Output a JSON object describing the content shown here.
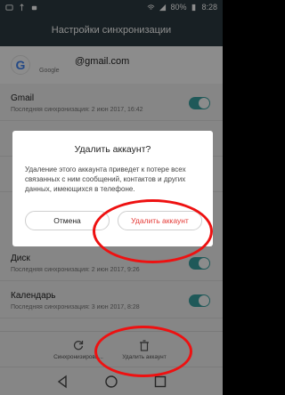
{
  "status_bar": {
    "battery": "80%",
    "time": "8:28",
    "icons": [
      "wifi-icon",
      "signal-icon",
      "battery-icon"
    ]
  },
  "title_bar": {
    "title": "Настройки синхронизации"
  },
  "account": {
    "email": "@gmail.com",
    "provider": "Google",
    "logo": "google-g-icon"
  },
  "sync_items": [
    {
      "name": "Gmail",
      "time": "Последняя синхронизация: 2 июн 2017, 16:42",
      "enabled": true
    },
    {
      "name": "",
      "time": "",
      "enabled": true
    },
    {
      "name": "",
      "time": "",
      "enabled": true
    },
    {
      "name": "Диск",
      "time": "Последняя синхронизация: 2 июн 2017, 9:26",
      "enabled": true
    },
    {
      "name": "Календарь",
      "time": "Последняя синхронизация: 3 июн 2017, 8:28",
      "enabled": true
    }
  ],
  "toolbar": {
    "sync_label": "Синхронизирова...",
    "sync_icon": "sync-icon",
    "delete_label": "Удалить аккаунт",
    "delete_icon": "trash-icon"
  },
  "dialog": {
    "title": "Удалить аккаунт?",
    "message": "Удаление этого аккаунта приведет к потере всех связанных с ним сообщений, контактов и других данных, имеющихся в телефоне.",
    "cancel_label": "Отмена",
    "confirm_label": "Удалить аккаунт"
  },
  "nav_bar": {
    "icons": [
      "back-icon",
      "home-icon",
      "recents-icon"
    ]
  },
  "colors": {
    "accent": "#3aa3a3",
    "header": "#2c3b42",
    "danger": "#e53935",
    "annotation": "#ee1111"
  }
}
